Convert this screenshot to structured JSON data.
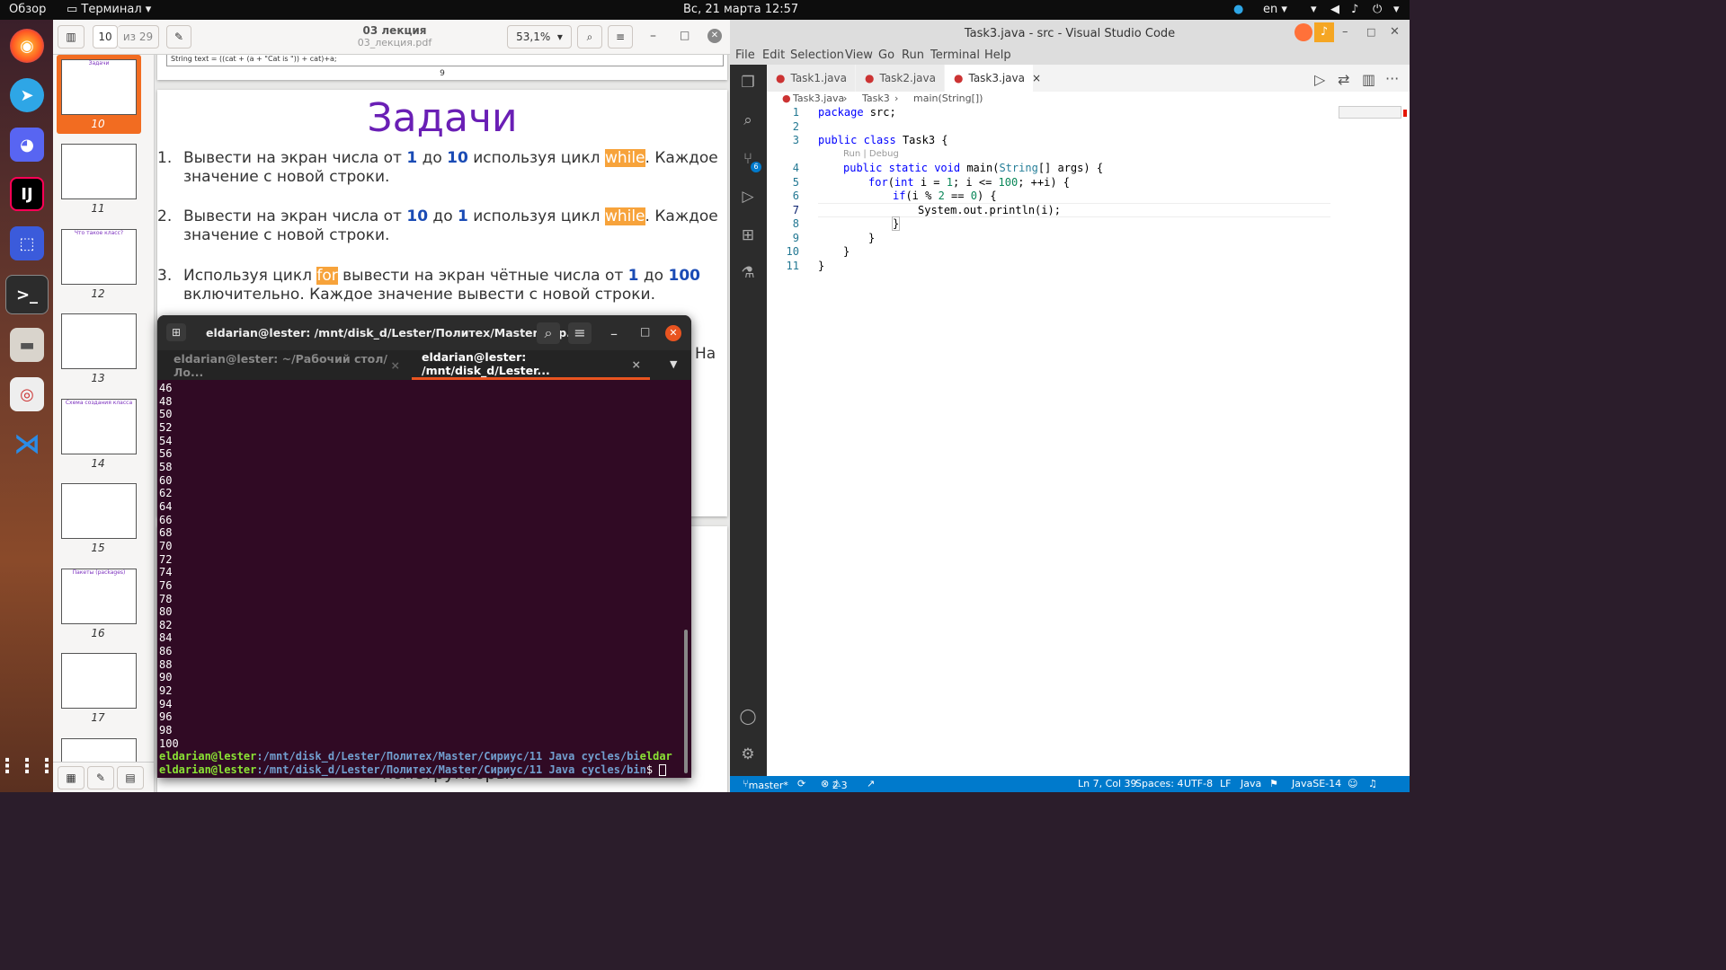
{
  "topbar": {
    "overview": "Обзор",
    "app_menu": "Терминал",
    "clock": "Вс, 21 марта  12:57",
    "lang": "en"
  },
  "evince": {
    "title": "03 лекция",
    "subtitle": "03_лекция.pdf",
    "page_input": "10",
    "page_of": "из 29",
    "zoom": "53,1%",
    "thumbs": [
      {
        "num": "10",
        "title": "Задачи"
      },
      {
        "num": "11",
        "title": ""
      },
      {
        "num": "12",
        "title": "Что такое класс?"
      },
      {
        "num": "13",
        "title": ""
      },
      {
        "num": "14",
        "title": "Схема создания класса"
      },
      {
        "num": "15",
        "title": ""
      },
      {
        "num": "16",
        "title": "Пакеты (packages)"
      },
      {
        "num": "17",
        "title": ""
      }
    ],
    "prev_page": {
      "code_line": "String text = ((cat + (a + \"Cat is \")) + cat)+a;",
      "number": "9"
    },
    "slide": {
      "title": "Задачи",
      "tasks": [
        {
          "n": "1.",
          "a": "Вывести на экран числа от ",
          "b1": "1",
          "c": " до ",
          "b2": "10",
          "d": " используя цикл ",
          "kw": "while",
          "e": ". Каждое значение с новой строки."
        },
        {
          "n": "2.",
          "a": "Вывести на экран числа от ",
          "b1": "10",
          "c": " до ",
          "b2": "1",
          "d": " используя цикл ",
          "kw": "while",
          "e": ". Каждое значение с новой строки."
        },
        {
          "n": "3.",
          "a": "Используя цикл ",
          "kw": "for",
          "d": " вывести на экран чётные числа от ",
          "b1": "1",
          "c": " до ",
          "b2": "100",
          "e": " включительно. Каждое значение вывести с новой строки."
        }
      ],
      "partial_right": "На"
    },
    "next_page_text": "конструкторы."
  },
  "terminal": {
    "title": "eldarian@lester: /mnt/disk_d/Lester/Политех/Master/Сир...",
    "tabs": [
      "eldarian@lester: ~/Рабочий стол/Ло...",
      "eldarian@lester: /mnt/disk_d/Lester..."
    ],
    "output": [
      "46",
      "48",
      "50",
      "52",
      "54",
      "56",
      "58",
      "60",
      "62",
      "64",
      "66",
      "68",
      "70",
      "72",
      "74",
      "76",
      "78",
      "80",
      "82",
      "84",
      "86",
      "88",
      "90",
      "92",
      "94",
      "96",
      "98",
      "100"
    ],
    "prompt_user": "eldarian@lester",
    "prompt1_path": ":/mnt/disk_d/Lester/Политех/Master/Сириус/11 Java cycles/bi",
    "prompt1_tail": "eldar",
    "prompt2_path": ":/mnt/disk_d/Lester/Политех/Master/Сириус/11 Java cycles/bin",
    "prompt_sign": "$ "
  },
  "vscode": {
    "title": "Task3.java - src - Visual Studio Code",
    "menu": [
      "File",
      "Edit",
      "Selection",
      "View",
      "Go",
      "Run",
      "Terminal",
      "Help"
    ],
    "tabs": [
      "Task1.java",
      "Task2.java",
      "Task3.java"
    ],
    "breadcrumb": [
      "Task3.java",
      "Task3",
      "main(String[])"
    ],
    "codelens": "Run | Debug",
    "line_numbers": [
      "1",
      "2",
      "3",
      "4",
      "5",
      "6",
      "7",
      "8",
      "9",
      "10",
      "11"
    ],
    "status": {
      "branch": "master*",
      "errors": "2",
      "warnings": "3",
      "position": "Ln 7, Col 39",
      "spaces": "Spaces: 4",
      "encoding": "UTF-8",
      "eol": "LF",
      "language": "Java",
      "jdk": "JavaSE-14"
    },
    "scm_badge": "6"
  },
  "code_tokens": {
    "l1a": "package",
    "l1b": " src;",
    "l3a": "public",
    "l3b": " ",
    "l3c": "class",
    "l3d": " Task3 {",
    "l4a": "public",
    "l4b": " ",
    "l4c": "static",
    "l4d": " ",
    "l4e": "void",
    "l4f": " main(",
    "l4g": "String",
    "l4h": "[] args) {",
    "l5a": "for",
    "l5b": "(",
    "l5c": "int",
    "l5d": " i = ",
    "l5e": "1",
    "l5f": "; i <= ",
    "l5g": "100",
    "l5h": "; ++i) {",
    "l6a": "if",
    "l6b": "(i % ",
    "l6c": "2",
    "l6d": " == ",
    "l6e": "0",
    "l6f": ") {",
    "l7": "System.out.println(i);",
    "l8": "}",
    "l9": "}",
    "l10": "}",
    "l11": "}"
  }
}
